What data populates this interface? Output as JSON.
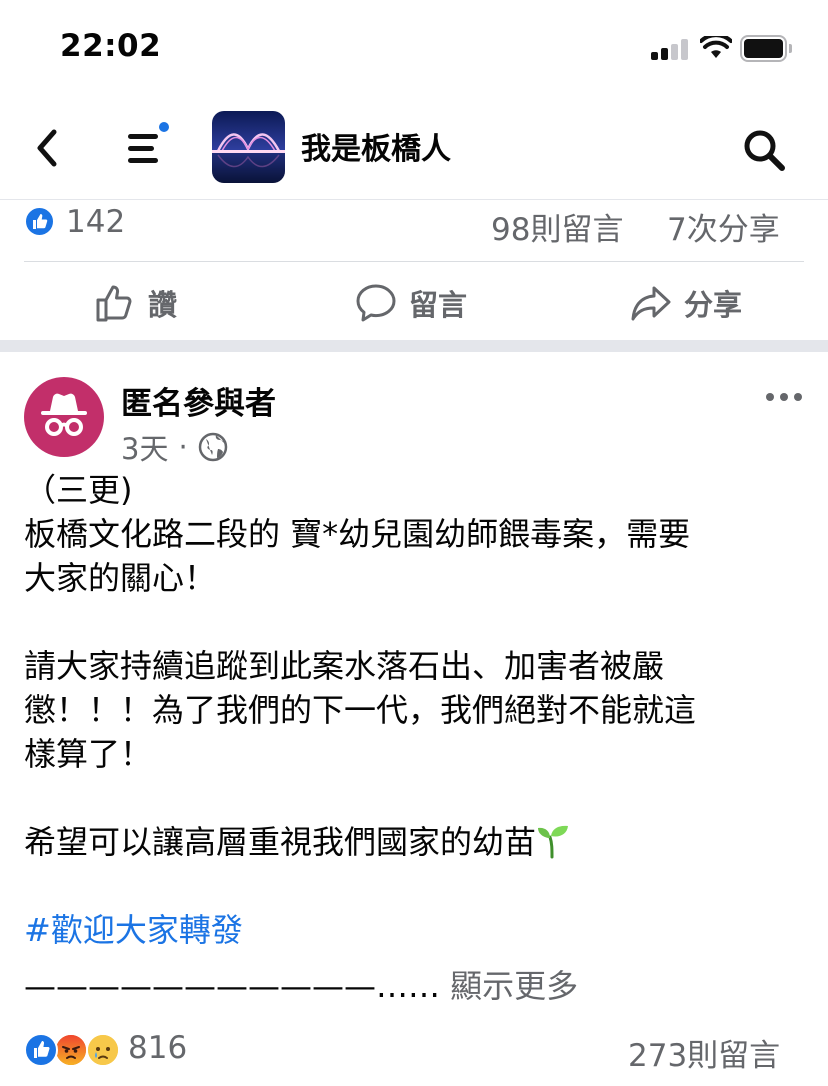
{
  "status_bar": {
    "time": "22:02",
    "icons": [
      "cellular-signal-icon",
      "wifi-icon",
      "battery-icon"
    ]
  },
  "nav": {
    "back_icon": "chevron-left-icon",
    "menu_icon": "menu-icon",
    "notification_dot_color": "#1b74e4",
    "group_name": "我是板橋人",
    "search_icon": "search-icon"
  },
  "first_post": {
    "like_count": "142",
    "comment_count": "98則留言",
    "share_count": "7次分享",
    "actions": {
      "like": "讚",
      "comment": "留言",
      "share": "分享"
    }
  },
  "second_post": {
    "author": "匿名參與者",
    "time_ago": "3天",
    "separator": "·",
    "privacy_icon": "globe-icon",
    "more_icon": "more-options-icon",
    "body": {
      "line1": "（三更)",
      "line2": "板橋文化路二段的 寶*幼兒園幼師餵毒案，需要",
      "line3": "大家的關心！",
      "line4": "請大家持續追蹤到此案水落石出、加害者被嚴",
      "line5": "懲！！！為了我們的下一代，我們絕對不能就這",
      "line6": "樣算了！",
      "line7": "希望可以讓高層重視我們國家的幼苗",
      "hashtag": "#歡迎大家轉發",
      "dashes": "———————————……",
      "show_more": "顯示更多"
    },
    "reactions": [
      "like",
      "angry",
      "sad"
    ],
    "reaction_count": "816",
    "comment_count": "273則留言"
  },
  "colors": {
    "accent": "#1b74e4",
    "secondary_text": "#65676b",
    "divider": "#dadde1",
    "anonymous_avatar": "#c22f6a"
  }
}
